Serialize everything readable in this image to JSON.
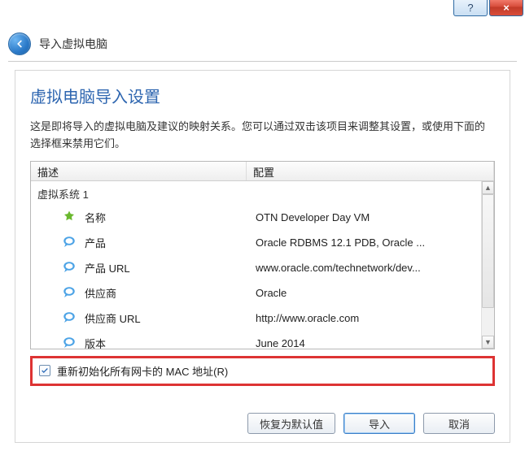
{
  "titlebar": {
    "help_glyph": "?",
    "close_glyph": "×"
  },
  "header": {
    "title": "导入虚拟电脑"
  },
  "page": {
    "title": "虚拟电脑导入设置",
    "desc": "这是即将导入的虚拟电脑及建议的映射关系。您可以通过双击该项目来调整其设置，或使用下面的选择框来禁用它们。"
  },
  "table": {
    "col1": "描述",
    "col2": "配置",
    "group": "虚拟系统 1",
    "rows": [
      {
        "icon": "name",
        "key": "名称",
        "value": "OTN Developer Day VM"
      },
      {
        "icon": "bubble",
        "key": "产品",
        "value": "Oracle RDBMS 12.1 PDB, Oracle ..."
      },
      {
        "icon": "bubble",
        "key": "产品 URL",
        "value": "www.oracle.com/technetwork/dev..."
      },
      {
        "icon": "bubble",
        "key": "供应商",
        "value": "Oracle"
      },
      {
        "icon": "bubble",
        "key": "供应商 URL",
        "value": "http://www.oracle.com"
      },
      {
        "icon": "bubble",
        "key": "版本",
        "value": "June 2014"
      }
    ]
  },
  "checkbox": {
    "label": "重新初始化所有网卡的 MAC 地址(R)"
  },
  "buttons": {
    "restore": "恢复为默认值",
    "import": "导入",
    "cancel": "取消"
  }
}
